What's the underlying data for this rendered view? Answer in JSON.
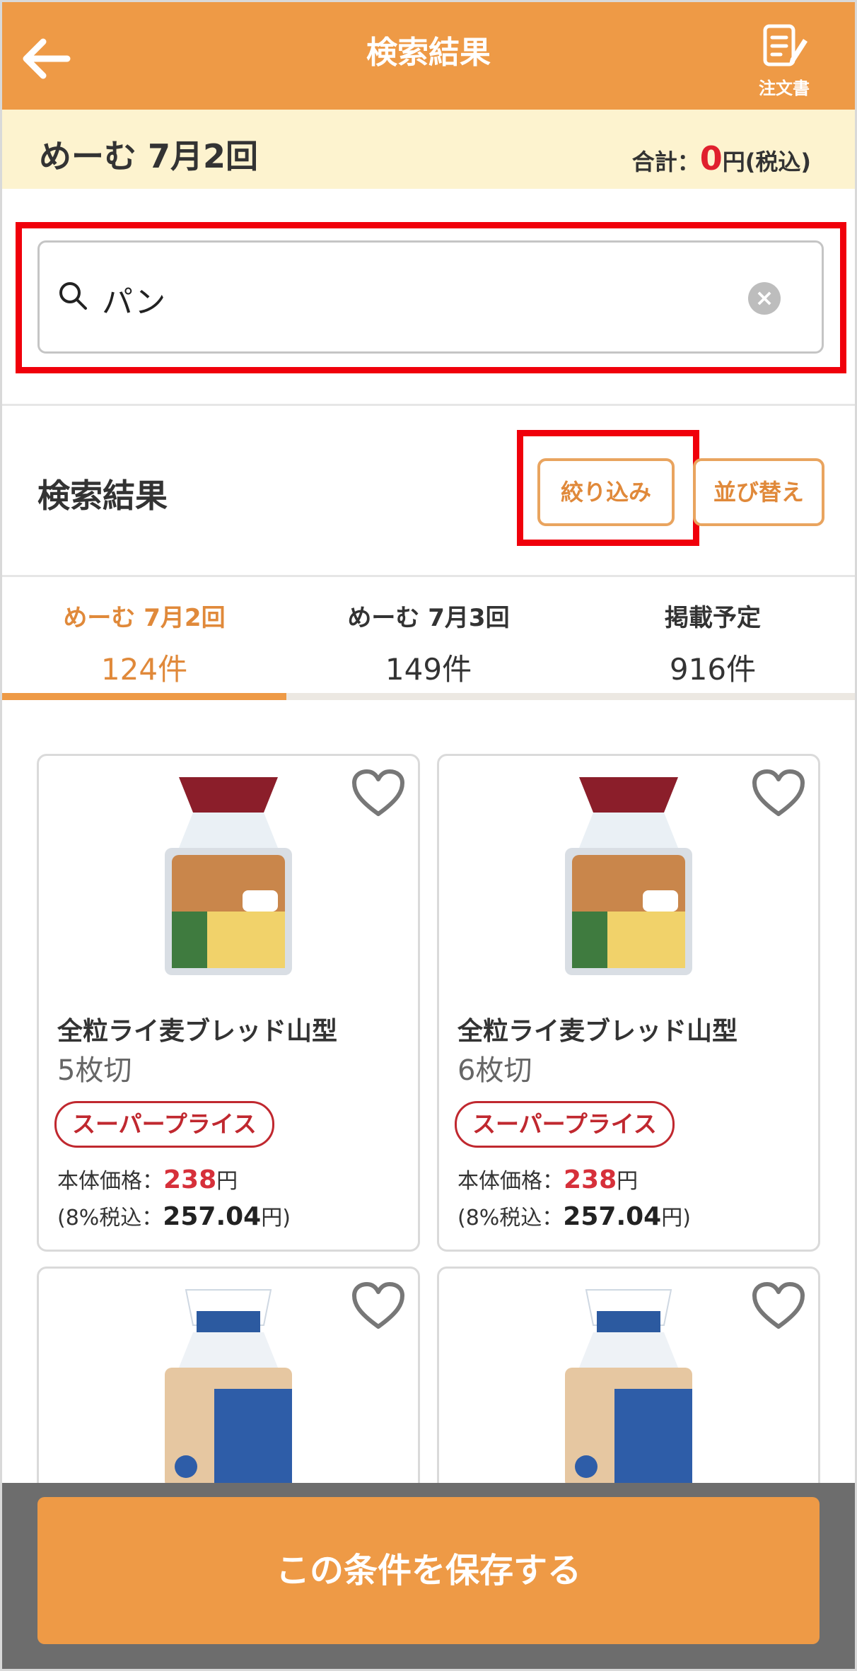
{
  "header": {
    "title": "検索結果",
    "order_label": "注文書"
  },
  "subbar": {
    "name": "めーむ 7月2回",
    "total_label": "合計：",
    "total_value": "0",
    "total_suffix": "円(税込)"
  },
  "search": {
    "value": "パン"
  },
  "results": {
    "title": "検索結果",
    "filter_label": "絞り込み",
    "sort_label": "並び替え"
  },
  "tabs": [
    {
      "label": "めーむ 7月2回",
      "count": "124件"
    },
    {
      "label": "めーむ 7月3回",
      "count": "149件"
    },
    {
      "label": "掲載予定",
      "count": "916件"
    }
  ],
  "products": [
    {
      "name": "全粒ライ麦ブレッド山型",
      "sub": "5枚切",
      "badge": "スーパープライス",
      "price_label": "本体価格：",
      "price": "238",
      "price_unit": "円",
      "tax_prefix": "(8%税込：",
      "tax_value": "257.04",
      "tax_suffix": "円)"
    },
    {
      "name": "全粒ライ麦ブレッド山型",
      "sub": "6枚切",
      "badge": "スーパープライス",
      "price_label": "本体価格：",
      "price": "238",
      "price_unit": "円",
      "tax_prefix": "(8%税込：",
      "tax_value": "257.04",
      "tax_suffix": "円)"
    }
  ],
  "footer": {
    "save_label": "この条件を保存する"
  },
  "colors": {
    "accent": "#ee9a46",
    "highlight": "#f0000b",
    "price": "#d6303a"
  }
}
